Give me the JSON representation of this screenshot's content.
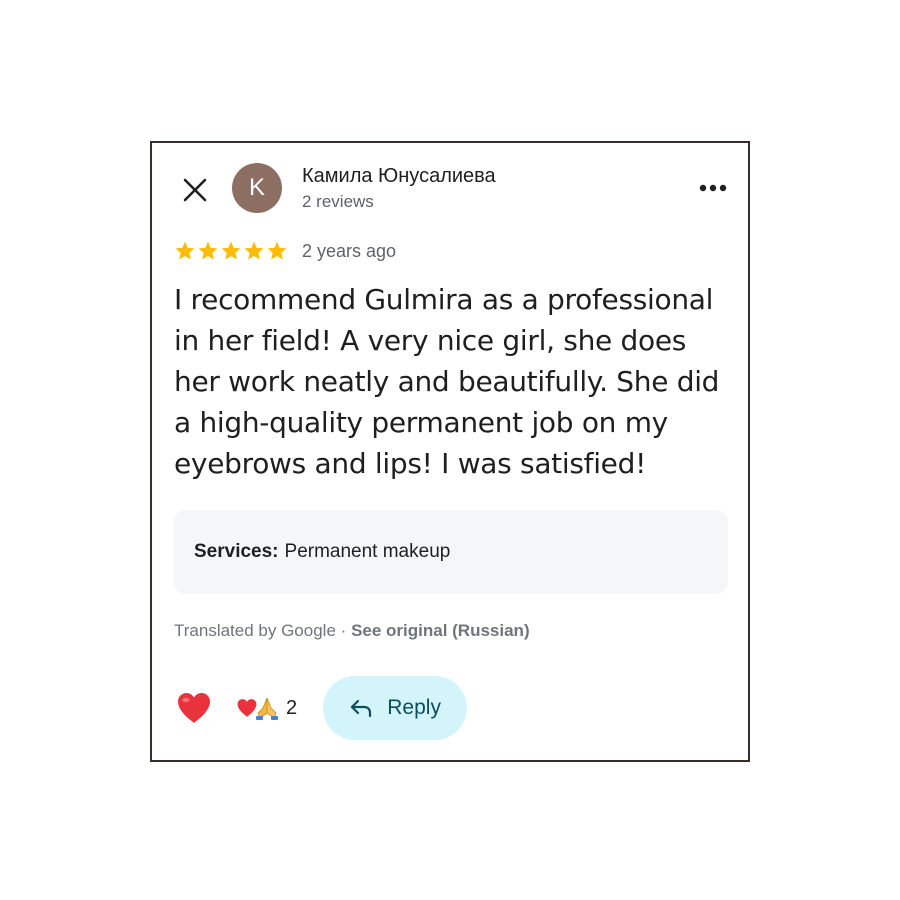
{
  "review": {
    "author_name": "Камила Юнусалиева",
    "author_initial": "K",
    "author_review_count": "2 reviews",
    "rating": 5,
    "rating_max": 5,
    "time_ago": "2 years ago",
    "text": "I recommend Gulmira as a professional in her field! A very nice girl, she does her work neatly and beautifully. She did a high-quality permanent job on my eyebrows and lips! I was satisfied!",
    "services_label": "Services:",
    "services_value": "Permanent makeup",
    "translated_by": "Translated by Google",
    "separator": "·",
    "see_original": "See original (Russian)"
  },
  "actions": {
    "reaction_count": "2",
    "reply_label": "Reply"
  },
  "icons": {
    "close": "close-icon",
    "more": "more-horizontal-icon",
    "star": "star-icon",
    "heart": "heart-icon",
    "reactions": [
      "heart-icon",
      "praying-hands-icon"
    ],
    "reply": "reply-arrow-icon"
  },
  "colors": {
    "card_border": "#3b2d2a",
    "avatar_bg": "#8d6e63",
    "star": "#fbbc04",
    "services_bg": "#f5f6f8",
    "reply_bg": "#d3f4fb",
    "reply_text": "#0b4f5c",
    "heart": "#e8333d"
  }
}
